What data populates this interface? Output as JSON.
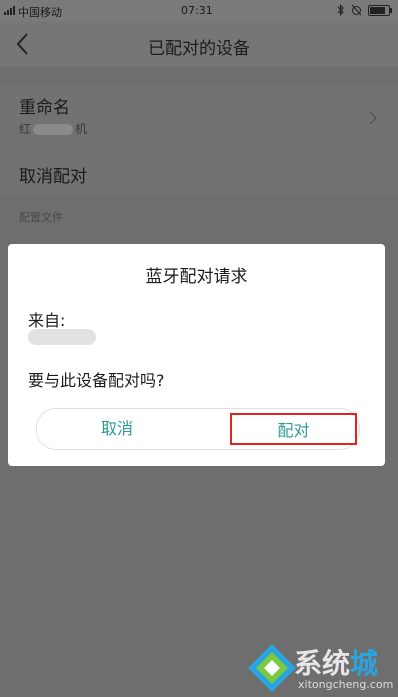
{
  "status_bar": {
    "carrier": "中国移动",
    "time": "07:31"
  },
  "nav": {
    "title": "已配对的设备"
  },
  "rows": {
    "rename_label": "重命名",
    "rename_sub_prefix": "红",
    "rename_sub_suffix": "机",
    "unpair_label": "取消配对",
    "section_header": "配置文件"
  },
  "dialog": {
    "title": "蓝牙配对请求",
    "from_label": "来自:",
    "question": "要与此设备配对吗?",
    "cancel_label": "取消",
    "pair_label": "配对"
  },
  "watermark": {
    "name_part1": "系统",
    "name_part2": "城",
    "url": "xitongcheng.com"
  },
  "colors": {
    "accent": "#2f9a8f",
    "highlight_border": "#e0251f"
  }
}
